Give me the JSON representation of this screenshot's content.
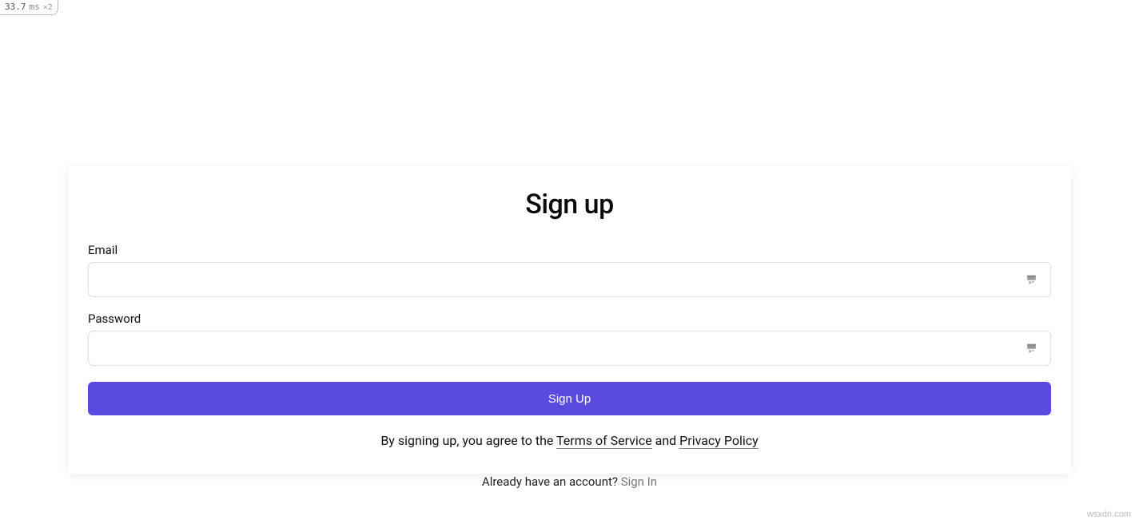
{
  "dev_badge": {
    "value": "33.7",
    "unit": "ms",
    "multiplier": "×2"
  },
  "form": {
    "heading": "Sign up",
    "email_label": "Email",
    "email_value": "",
    "password_label": "Password",
    "password_value": "",
    "submit_label": "Sign Up",
    "agreement_prefix": "By signing up, you agree to the ",
    "tos_label": "Terms of Service",
    "agreement_conjunction": " and ",
    "privacy_label": "Privacy Policy"
  },
  "below": {
    "prompt": "Already have an account? ",
    "signin_label": "Sign In"
  },
  "attribution": "wsxdn.com"
}
